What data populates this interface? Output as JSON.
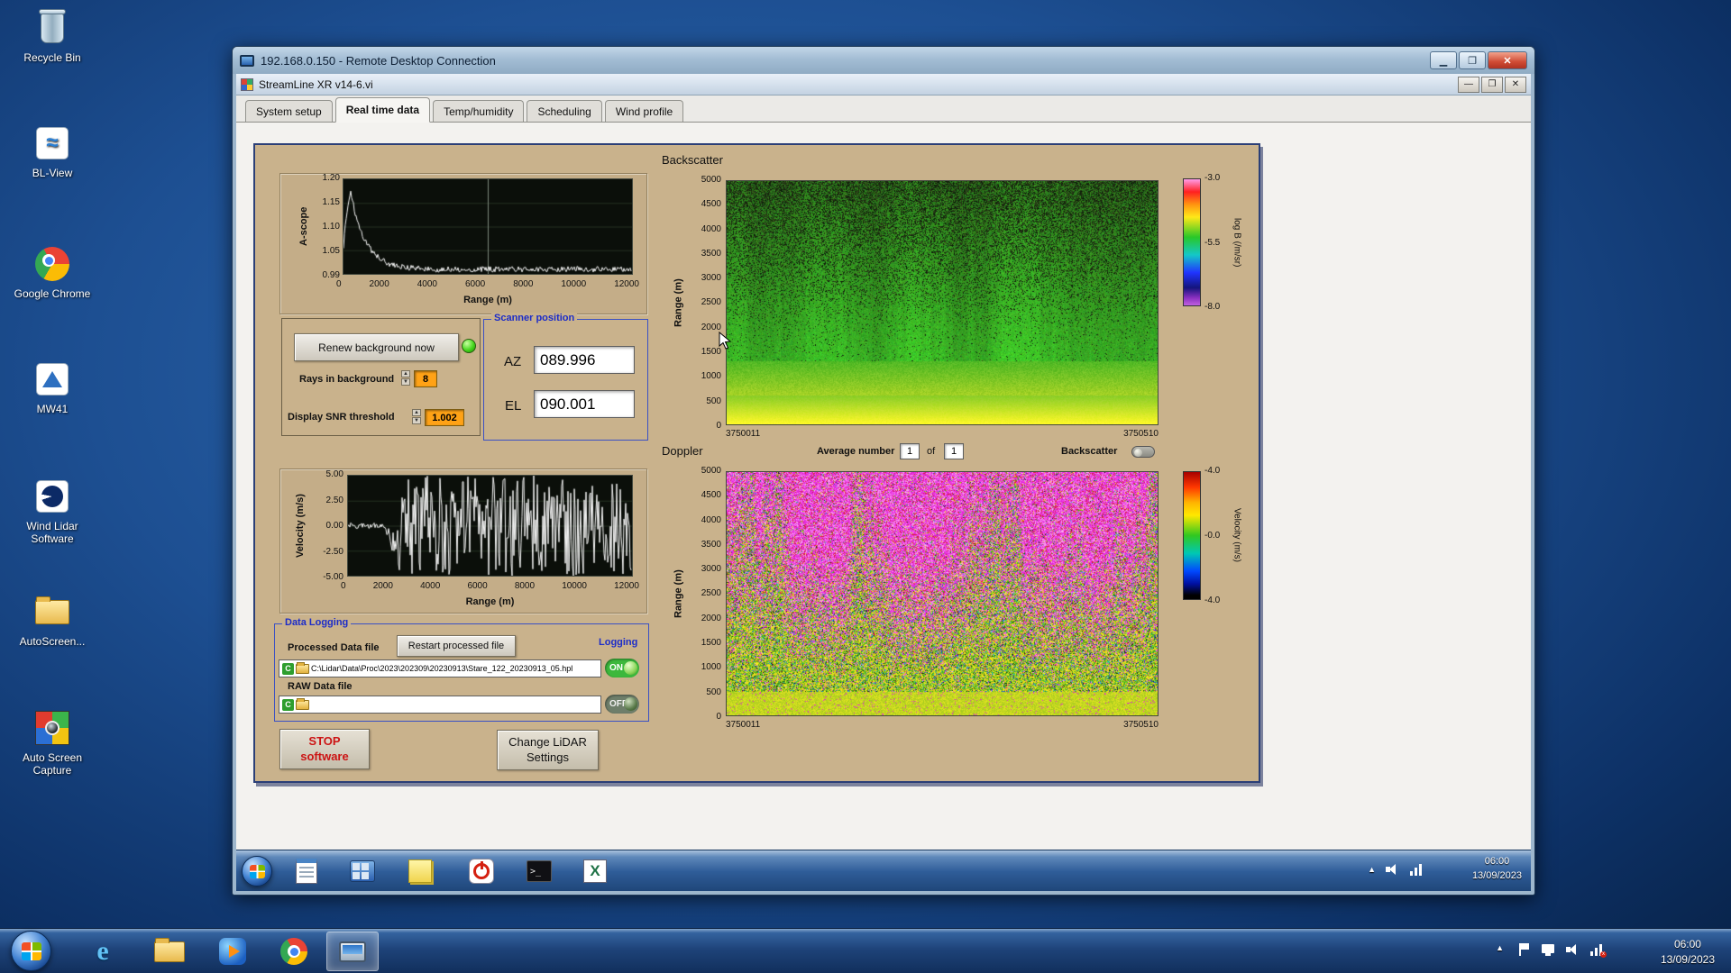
{
  "desktop": {
    "icons": [
      {
        "label": "Recycle Bin"
      },
      {
        "label": "BL-View"
      },
      {
        "label": "Google Chrome"
      },
      {
        "label": "MW41"
      },
      {
        "label": "Wind Lidar Software"
      },
      {
        "label": "AutoScreen..."
      },
      {
        "label": "Auto Screen Capture"
      }
    ]
  },
  "rdp_window": {
    "title": "192.168.0.150 - Remote Desktop Connection"
  },
  "app_window": {
    "title": "StreamLine XR v14-6.vi",
    "tabs": [
      "System setup",
      "Real time data",
      "Temp/humidity",
      "Scheduling",
      "Wind profile"
    ],
    "active_tab": "Real time data"
  },
  "controls": {
    "renew_background_button": "Renew background now",
    "rays_in_background_label": "Rays in background",
    "rays_in_background_value": "8",
    "snr_threshold_label": "Display SNR threshold",
    "snr_threshold_value": "1.002",
    "scanner_position": {
      "title": "Scanner position",
      "az_label": "AZ",
      "az_value": "089.996",
      "el_label": "EL",
      "el_value": "090.001"
    },
    "average_number_label": "Average number",
    "average_number_value": "1",
    "of_label": "of",
    "of_value": "1",
    "backscatter_toggle_label": "Backscatter",
    "data_logging": {
      "title": "Data Logging",
      "processed_file_label": "Processed Data file",
      "restart_button": "Restart processed file",
      "logging_label": "Logging",
      "processed_path": "C:\\Lidar\\Data\\Proc\\2023\\202309\\20230913\\Stare_122_20230913_05.hpl",
      "processed_toggle": "ON",
      "raw_file_label": "RAW Data file",
      "raw_path": "",
      "raw_toggle": "OFF"
    },
    "stop_button_line1": "STOP",
    "stop_button_line2": "software",
    "change_settings_line1": "Change LiDAR",
    "change_settings_line2": "Settings"
  },
  "chart_data": [
    {
      "id": "ascope",
      "type": "line",
      "title": "A-scope",
      "xlabel": "Range (m)",
      "ylabel": "A-scope",
      "xlim": [
        0,
        12000
      ],
      "ylim": [
        0.99,
        1.2
      ],
      "xticks": [
        "0",
        "2000",
        "4000",
        "6000",
        "8000",
        "10000",
        "12000"
      ],
      "yticks": [
        "1.20",
        "1.15",
        "1.10",
        "1.05",
        "0.99"
      ],
      "series": [
        {
          "name": "a-scope",
          "x": [
            0,
            150,
            300,
            600,
            1000,
            1600,
            2500,
            4000,
            6000,
            9000,
            12000
          ],
          "y": [
            1.07,
            1.15,
            1.17,
            1.1,
            1.05,
            1.02,
            1.005,
            1.0,
            1.0,
            1.0,
            1.0
          ]
        }
      ],
      "grid": "vertical gridline at 6000 m",
      "description": "White trace on black: sharp peak ~1.17 near 300 m decaying to a flat noisy baseline of ~1.00 out to 12000 m"
    },
    {
      "id": "velocity",
      "type": "line",
      "xlabel": "Range (m)",
      "ylabel": "Velocity (m/s)",
      "xlim": [
        0,
        12000
      ],
      "ylim": [
        -5,
        5
      ],
      "xticks": [
        "0",
        "2000",
        "4000",
        "6000",
        "8000",
        "10000",
        "12000"
      ],
      "yticks": [
        "5.00",
        "2.50",
        "0.00",
        "-2.50",
        "-5.00"
      ],
      "series": [
        {
          "name": "velocity",
          "summary": "near 0 m/s from 0-1700 m, then full-scale random noise spanning -5 to +5 m/s out to 12000 m"
        }
      ],
      "description": "White trace on black: quiet near-zero segment then dense vertical noise filling the full y-range"
    },
    {
      "id": "backscatter",
      "type": "heatmap",
      "title": "Backscatter",
      "ylabel": "Range (m)",
      "ylim": [
        0,
        5000
      ],
      "yticks": [
        "5000",
        "4500",
        "4000",
        "3500",
        "3000",
        "2500",
        "2000",
        "1500",
        "1000",
        "500",
        "0"
      ],
      "x_start_label": "3750011",
      "x_end_label": "3750510",
      "colorbar": {
        "title": "log B (/m/sr)",
        "ticks": [
          "-3.0",
          "-5.5",
          "-8.0"
        ]
      },
      "description": "Speckled green noise field; black speckle density increases with altitude; bright yellow high-backscatter band below ~500 m"
    },
    {
      "id": "doppler",
      "type": "heatmap",
      "title": "Doppler",
      "ylabel": "Range (m)",
      "ylim": [
        0,
        5000
      ],
      "yticks": [
        "5000",
        "4500",
        "4000",
        "3500",
        "3000",
        "2500",
        "2000",
        "1500",
        "1000",
        "500",
        "0"
      ],
      "x_start_label": "3750011",
      "x_end_label": "3750510",
      "colorbar": {
        "title": "Velocity (m/s)",
        "ticks": [
          "-4.0",
          "-0.0",
          "-4.0"
        ]
      },
      "description": "Random velocity noise: magenta/pink dominant aloft with vertical streaks, yellow-green dominant at low ranges, smooth yellow-green band below ~500 m"
    }
  ],
  "icons": {
    "ie_glyph": "e",
    "cmd_glyph": ">_",
    "excel_glyph": "X"
  },
  "inner_taskbar": {
    "time": "06:00",
    "date": "13/09/2023"
  },
  "outer_taskbar": {
    "time": "06:00",
    "date": "13/09/2023"
  }
}
